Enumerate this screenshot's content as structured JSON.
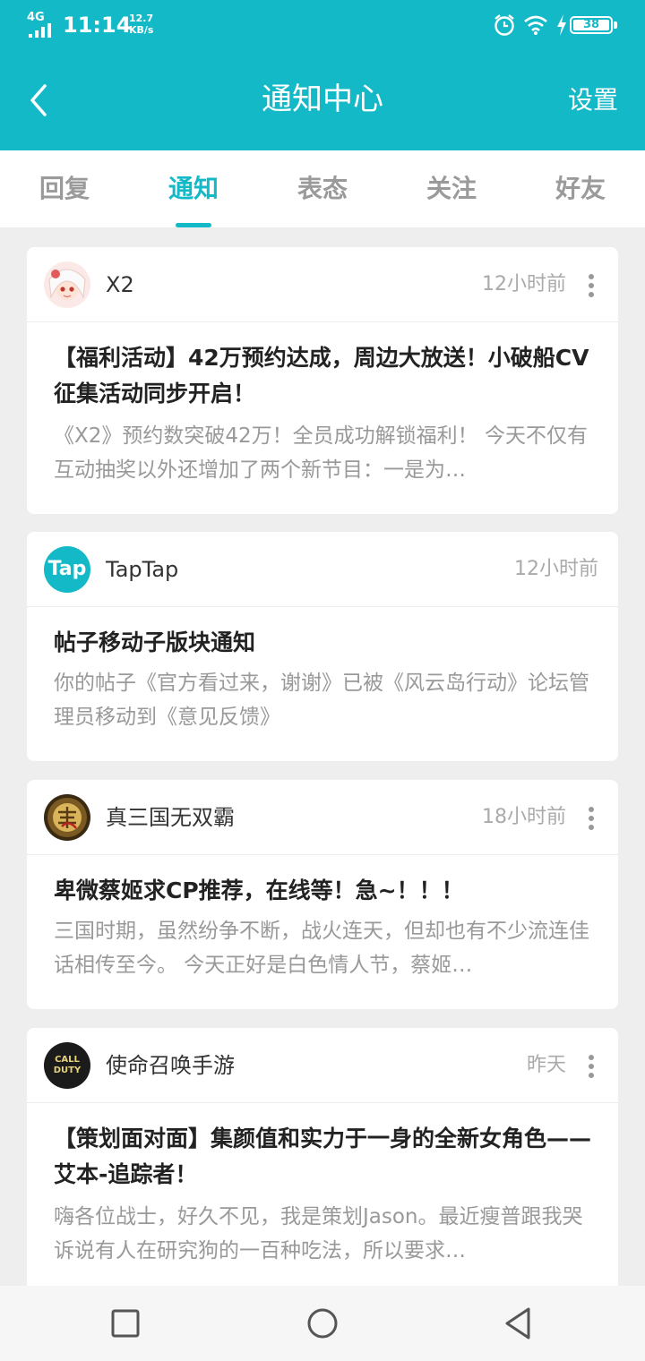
{
  "status_bar": {
    "network": "4G",
    "time": "11:14",
    "speed_value": "12.7",
    "speed_unit": "KB/s",
    "battery": "38",
    "icons": [
      "signal-icon",
      "alarm-icon",
      "wifi-icon",
      "charging-icon",
      "battery-icon"
    ]
  },
  "header": {
    "title": "通知中心",
    "settings_label": "设置",
    "back_icon": "back-arrow-icon"
  },
  "tabs": [
    {
      "label": "回复",
      "active": false
    },
    {
      "label": "通知",
      "active": true
    },
    {
      "label": "表态",
      "active": false
    },
    {
      "label": "关注",
      "active": false
    },
    {
      "label": "好友",
      "active": false
    }
  ],
  "notifications": [
    {
      "author": "X2",
      "time": "12小时前",
      "has_more_menu": true,
      "title": "【福利活动】42万预约达成，周边大放送！小破船CV征集活动同步开启！",
      "body": "《X2》预约数突破42万！全员成功解锁福利！ 今天不仅有互动抽奖以外还增加了两个新节目：一是为…"
    },
    {
      "author": "TapTap",
      "avatar_text": "Tap",
      "time": "12小时前",
      "has_more_menu": false,
      "title": "帖子移动子版块通知",
      "body": "你的帖子《官方看过来，谢谢》已被《风云岛行动》论坛管理员移动到《意见反馈》"
    },
    {
      "author": "真三国无双霸",
      "time": "18小时前",
      "has_more_menu": true,
      "title": "卑微蔡姬求CP推荐，在线等！急~！！！",
      "body": "三国时期，虽然纷争不断，战火连天，但却也有不少流连佳话相传至今。 今天正好是白色情人节，蔡姬…"
    },
    {
      "author": "使命召唤手游",
      "avatar_text": "CALL DUTY",
      "time": "昨天",
      "has_more_menu": true,
      "title": "【策划面对面】集颜值和实力于一身的全新女角色——艾本-追踪者！",
      "body": "嗨各位战士，好久不见，我是策划Jason。最近瘦普跟我哭诉说有人在研究狗的一百种吃法，所以要求…"
    }
  ],
  "nav_bar": {
    "buttons": [
      "recents-square-icon",
      "home-circle-icon",
      "back-triangle-icon"
    ]
  },
  "colors": {
    "accent": "#14b9c8",
    "background": "#eeeeee",
    "title_text": "#222222",
    "muted_text": "#999999"
  }
}
